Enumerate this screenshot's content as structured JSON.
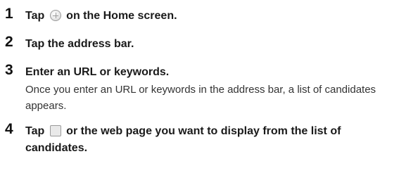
{
  "steps": [
    {
      "number": "1",
      "text_before": "Tap",
      "icon": "browser-icon",
      "text_after": "on the Home screen."
    },
    {
      "number": "2",
      "text": "Tap the address bar."
    },
    {
      "number": "3",
      "text": "Enter an URL or keywords.",
      "detail": "Once you enter an URL or keywords in the address bar, a list of candidates appears."
    },
    {
      "number": "4",
      "text_before": "Tap",
      "icon": "go-icon",
      "text_after": "or the web page you want to display from the list of candidates."
    }
  ]
}
